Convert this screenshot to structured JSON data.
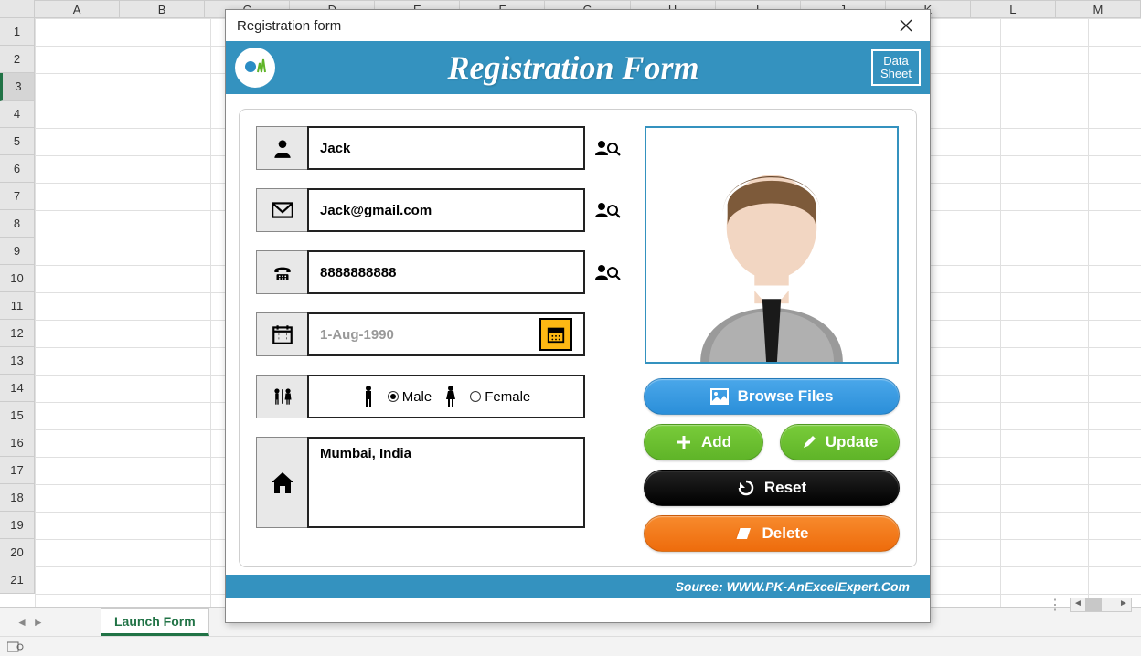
{
  "dialog": {
    "title": "Registration form",
    "banner_title": "Registration Form",
    "data_sheet": "Data\nSheet"
  },
  "fields": {
    "name": "Jack",
    "email": "Jack@gmail.com",
    "phone": "8888888888",
    "dob_placeholder": "1-Aug-1990",
    "gender_male": "Male",
    "gender_female": "Female",
    "gender_selected": "Male",
    "address": "Mumbai, India"
  },
  "buttons": {
    "browse": "Browse Files",
    "add": "Add",
    "update": "Update",
    "reset": "Reset",
    "delete": "Delete"
  },
  "footer": "Source: WWW.PK-AnExcelExpert.Com",
  "excel": {
    "columns": [
      "A",
      "B",
      "C",
      "D",
      "E",
      "F",
      "G",
      "H",
      "I",
      "J",
      "K",
      "L",
      "M"
    ],
    "rows": [
      "1",
      "2",
      "3",
      "4",
      "5",
      "6",
      "7",
      "8",
      "9",
      "10",
      "11",
      "12",
      "13",
      "14",
      "15",
      "16",
      "17",
      "18",
      "19",
      "20",
      "21"
    ],
    "selected_row": 3,
    "sheet_tab": "Launch Form"
  }
}
